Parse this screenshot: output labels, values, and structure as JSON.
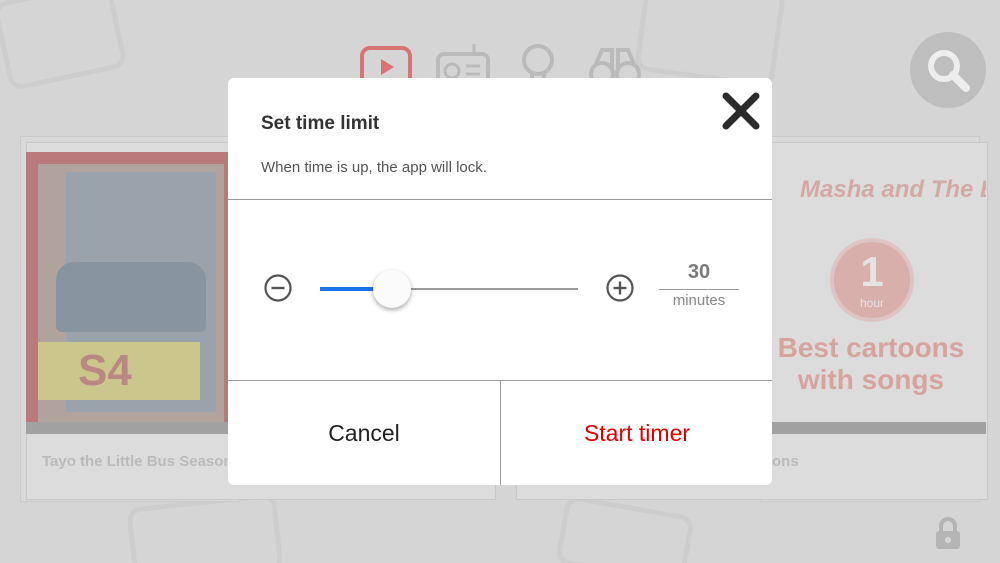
{
  "nav": {
    "icons": [
      "video-icon",
      "radio-icon",
      "lightbulb-icon",
      "binoculars-icon"
    ],
    "active_color": "#e53935"
  },
  "cards": {
    "left_title": "Tayo the Little Bus Season",
    "left_badge": "S4",
    "right_title_fragment": "ons",
    "right_logo": "Masha and The Bear",
    "right_badge_number": "1",
    "right_badge_word": "hour",
    "right_promo": "Best cartoons with songs"
  },
  "dialog": {
    "title": "Set time limit",
    "subtitle": "When time is up, the app will lock.",
    "minutes_value": "30",
    "minutes_unit": "minutes",
    "slider_fraction": 0.28,
    "cancel_label": "Cancel",
    "start_label": "Start timer"
  },
  "colors": {
    "accent_blue": "#1a73e8",
    "start_red": "#e00000",
    "overlay": "#e4e4e4"
  }
}
